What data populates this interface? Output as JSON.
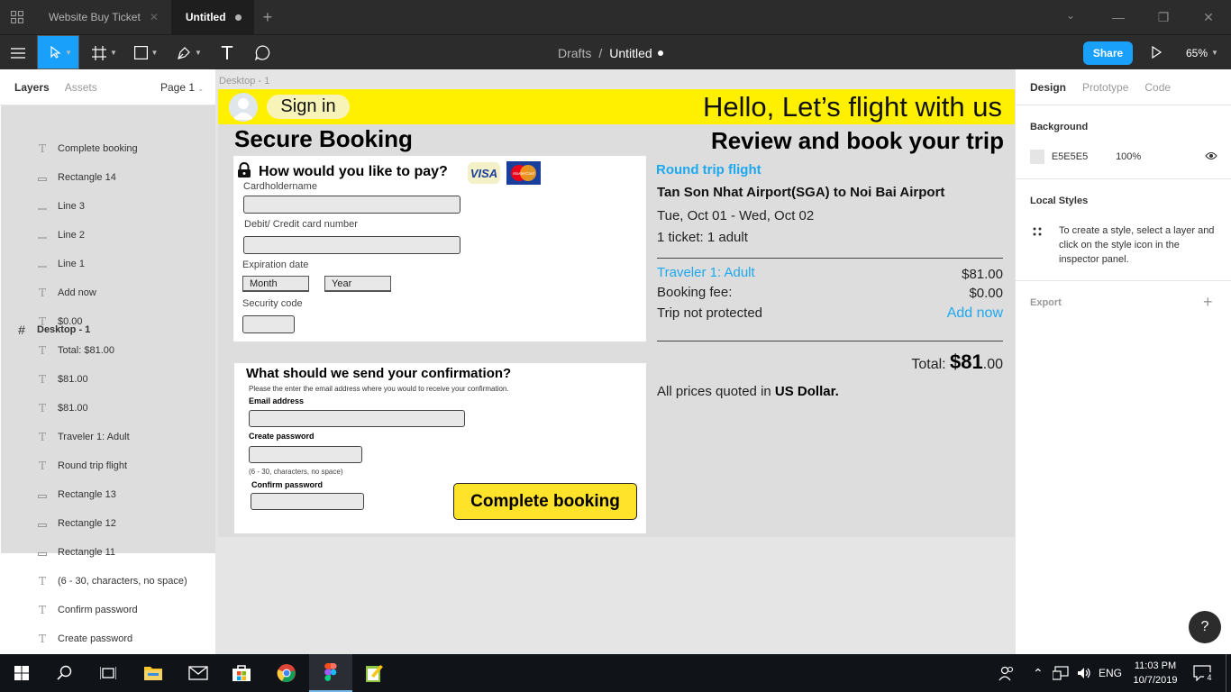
{
  "tabs": [
    {
      "label": "Website Buy Ticket"
    },
    {
      "label": "Untitled"
    }
  ],
  "toolbar": {
    "breadcrumb_parent": "Drafts",
    "breadcrumb_sep": "/",
    "breadcrumb_current": "Untitled",
    "share_label": "Share",
    "zoom_label": "65%"
  },
  "left_panel": {
    "tab_layers": "Layers",
    "tab_assets": "Assets",
    "page_selector": "Page 1",
    "frame_name": "Desktop - 1",
    "layers": [
      {
        "name": "Complete booking",
        "type": "text"
      },
      {
        "name": "Rectangle 14",
        "type": "rect"
      },
      {
        "name": "Line 3",
        "type": "line"
      },
      {
        "name": "Line 2",
        "type": "line"
      },
      {
        "name": "Line 1",
        "type": "line"
      },
      {
        "name": "Add now",
        "type": "text"
      },
      {
        "name": "$0.00",
        "type": "text"
      },
      {
        "name": "Total: $81.00",
        "type": "text"
      },
      {
        "name": "$81.00",
        "type": "text"
      },
      {
        "name": "$81.00",
        "type": "text"
      },
      {
        "name": "Traveler 1: Adult",
        "type": "text"
      },
      {
        "name": "Round trip flight",
        "type": "text"
      },
      {
        "name": "Rectangle 13",
        "type": "rect"
      },
      {
        "name": "Rectangle 12",
        "type": "rect"
      },
      {
        "name": "Rectangle 11",
        "type": "rect"
      },
      {
        "name": "(6 - 30, characters, no space)",
        "type": "text"
      },
      {
        "name": "Confirm password",
        "type": "text"
      },
      {
        "name": "Create password",
        "type": "text"
      }
    ]
  },
  "right_panel": {
    "tab_design": "Design",
    "tab_prototype": "Prototype",
    "tab_code": "Code",
    "background_title": "Background",
    "background_hex": "E5E5E5",
    "background_opacity": "100%",
    "local_styles_title": "Local Styles",
    "local_styles_desc": "To create a style, select a layer and click on the style icon in the inspector panel.",
    "export_title": "Export",
    "export_add": "+",
    "help": "?"
  },
  "canvas": {
    "frame_label": "Desktop - 1",
    "design": {
      "sign_in": "Sign in",
      "hello": "Hello, Let’s flight with us",
      "secure_booking": "Secure Booking",
      "review_title": "Review and book your trip",
      "pay_title": "How would you like to pay?",
      "visa": "VISA",
      "mastercard": "MasterCard",
      "cardholder_label": "Cardholdername",
      "card_number_label": "Debit/ Credit card number",
      "expiration_label": "Expiration date",
      "month": "Month",
      "year": "Year",
      "security_label": "Security code",
      "confirmation_title": "What should we send your confirmation?",
      "confirmation_desc": "Please the enter the email address where  you would to receive your confirmation.",
      "email_label": "Email address",
      "create_password_label": "Create password",
      "password_hint": "(6 - 30, characters, no space)",
      "confirm_password_label": "Confirm password",
      "complete_booking": "Complete booking",
      "round_trip": "Round trip flight",
      "route": "Tan Son Nhat Airport(SGA) to Noi Bai Airport",
      "dates": "Tue, Oct 01 - Wed, Oct 02",
      "tickets": "1 ticket:  1 adult",
      "traveler": "Traveler 1: Adult",
      "traveler_price": "$81.00",
      "fee_label": "Booking fee:",
      "fee_value": "$0.00",
      "trip_protect": "Trip not protected",
      "add_now": "Add now",
      "total_prefix": "Total: ",
      "total_whole": "$81",
      "total_cents": ".00",
      "prices_prefix": "All prices quoted in ",
      "prices_currency": "US Dollar."
    }
  },
  "taskbar": {
    "lang": "ENG",
    "time": "11:03 PM",
    "date": "10/7/2019",
    "notif_count": "4"
  },
  "colors": {
    "accent": "#18a0fb",
    "yellow": "#fff000",
    "link_blue": "#1da8f0",
    "frame_bg": "#e5e5e5"
  }
}
